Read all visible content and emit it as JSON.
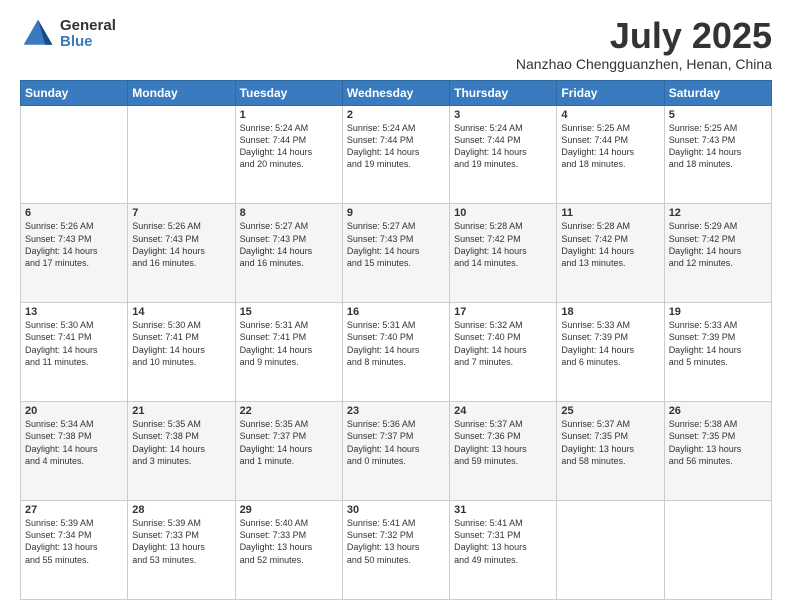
{
  "logo": {
    "general": "General",
    "blue": "Blue"
  },
  "title": {
    "month": "July 2025",
    "location": "Nanzhao Chengguanzhen, Henan, China"
  },
  "days": [
    "Sunday",
    "Monday",
    "Tuesday",
    "Wednesday",
    "Thursday",
    "Friday",
    "Saturday"
  ],
  "rows": [
    [
      {
        "day": "",
        "lines": []
      },
      {
        "day": "",
        "lines": []
      },
      {
        "day": "1",
        "lines": [
          "Sunrise: 5:24 AM",
          "Sunset: 7:44 PM",
          "Daylight: 14 hours",
          "and 20 minutes."
        ]
      },
      {
        "day": "2",
        "lines": [
          "Sunrise: 5:24 AM",
          "Sunset: 7:44 PM",
          "Daylight: 14 hours",
          "and 19 minutes."
        ]
      },
      {
        "day": "3",
        "lines": [
          "Sunrise: 5:24 AM",
          "Sunset: 7:44 PM",
          "Daylight: 14 hours",
          "and 19 minutes."
        ]
      },
      {
        "day": "4",
        "lines": [
          "Sunrise: 5:25 AM",
          "Sunset: 7:44 PM",
          "Daylight: 14 hours",
          "and 18 minutes."
        ]
      },
      {
        "day": "5",
        "lines": [
          "Sunrise: 5:25 AM",
          "Sunset: 7:43 PM",
          "Daylight: 14 hours",
          "and 18 minutes."
        ]
      }
    ],
    [
      {
        "day": "6",
        "lines": [
          "Sunrise: 5:26 AM",
          "Sunset: 7:43 PM",
          "Daylight: 14 hours",
          "and 17 minutes."
        ]
      },
      {
        "day": "7",
        "lines": [
          "Sunrise: 5:26 AM",
          "Sunset: 7:43 PM",
          "Daylight: 14 hours",
          "and 16 minutes."
        ]
      },
      {
        "day": "8",
        "lines": [
          "Sunrise: 5:27 AM",
          "Sunset: 7:43 PM",
          "Daylight: 14 hours",
          "and 16 minutes."
        ]
      },
      {
        "day": "9",
        "lines": [
          "Sunrise: 5:27 AM",
          "Sunset: 7:43 PM",
          "Daylight: 14 hours",
          "and 15 minutes."
        ]
      },
      {
        "day": "10",
        "lines": [
          "Sunrise: 5:28 AM",
          "Sunset: 7:42 PM",
          "Daylight: 14 hours",
          "and 14 minutes."
        ]
      },
      {
        "day": "11",
        "lines": [
          "Sunrise: 5:28 AM",
          "Sunset: 7:42 PM",
          "Daylight: 14 hours",
          "and 13 minutes."
        ]
      },
      {
        "day": "12",
        "lines": [
          "Sunrise: 5:29 AM",
          "Sunset: 7:42 PM",
          "Daylight: 14 hours",
          "and 12 minutes."
        ]
      }
    ],
    [
      {
        "day": "13",
        "lines": [
          "Sunrise: 5:30 AM",
          "Sunset: 7:41 PM",
          "Daylight: 14 hours",
          "and 11 minutes."
        ]
      },
      {
        "day": "14",
        "lines": [
          "Sunrise: 5:30 AM",
          "Sunset: 7:41 PM",
          "Daylight: 14 hours",
          "and 10 minutes."
        ]
      },
      {
        "day": "15",
        "lines": [
          "Sunrise: 5:31 AM",
          "Sunset: 7:41 PM",
          "Daylight: 14 hours",
          "and 9 minutes."
        ]
      },
      {
        "day": "16",
        "lines": [
          "Sunrise: 5:31 AM",
          "Sunset: 7:40 PM",
          "Daylight: 14 hours",
          "and 8 minutes."
        ]
      },
      {
        "day": "17",
        "lines": [
          "Sunrise: 5:32 AM",
          "Sunset: 7:40 PM",
          "Daylight: 14 hours",
          "and 7 minutes."
        ]
      },
      {
        "day": "18",
        "lines": [
          "Sunrise: 5:33 AM",
          "Sunset: 7:39 PM",
          "Daylight: 14 hours",
          "and 6 minutes."
        ]
      },
      {
        "day": "19",
        "lines": [
          "Sunrise: 5:33 AM",
          "Sunset: 7:39 PM",
          "Daylight: 14 hours",
          "and 5 minutes."
        ]
      }
    ],
    [
      {
        "day": "20",
        "lines": [
          "Sunrise: 5:34 AM",
          "Sunset: 7:38 PM",
          "Daylight: 14 hours",
          "and 4 minutes."
        ]
      },
      {
        "day": "21",
        "lines": [
          "Sunrise: 5:35 AM",
          "Sunset: 7:38 PM",
          "Daylight: 14 hours",
          "and 3 minutes."
        ]
      },
      {
        "day": "22",
        "lines": [
          "Sunrise: 5:35 AM",
          "Sunset: 7:37 PM",
          "Daylight: 14 hours",
          "and 1 minute."
        ]
      },
      {
        "day": "23",
        "lines": [
          "Sunrise: 5:36 AM",
          "Sunset: 7:37 PM",
          "Daylight: 14 hours",
          "and 0 minutes."
        ]
      },
      {
        "day": "24",
        "lines": [
          "Sunrise: 5:37 AM",
          "Sunset: 7:36 PM",
          "Daylight: 13 hours",
          "and 59 minutes."
        ]
      },
      {
        "day": "25",
        "lines": [
          "Sunrise: 5:37 AM",
          "Sunset: 7:35 PM",
          "Daylight: 13 hours",
          "and 58 minutes."
        ]
      },
      {
        "day": "26",
        "lines": [
          "Sunrise: 5:38 AM",
          "Sunset: 7:35 PM",
          "Daylight: 13 hours",
          "and 56 minutes."
        ]
      }
    ],
    [
      {
        "day": "27",
        "lines": [
          "Sunrise: 5:39 AM",
          "Sunset: 7:34 PM",
          "Daylight: 13 hours",
          "and 55 minutes."
        ]
      },
      {
        "day": "28",
        "lines": [
          "Sunrise: 5:39 AM",
          "Sunset: 7:33 PM",
          "Daylight: 13 hours",
          "and 53 minutes."
        ]
      },
      {
        "day": "29",
        "lines": [
          "Sunrise: 5:40 AM",
          "Sunset: 7:33 PM",
          "Daylight: 13 hours",
          "and 52 minutes."
        ]
      },
      {
        "day": "30",
        "lines": [
          "Sunrise: 5:41 AM",
          "Sunset: 7:32 PM",
          "Daylight: 13 hours",
          "and 50 minutes."
        ]
      },
      {
        "day": "31",
        "lines": [
          "Sunrise: 5:41 AM",
          "Sunset: 7:31 PM",
          "Daylight: 13 hours",
          "and 49 minutes."
        ]
      },
      {
        "day": "",
        "lines": []
      },
      {
        "day": "",
        "lines": []
      }
    ]
  ],
  "row_shading": [
    false,
    true,
    false,
    true,
    false
  ]
}
